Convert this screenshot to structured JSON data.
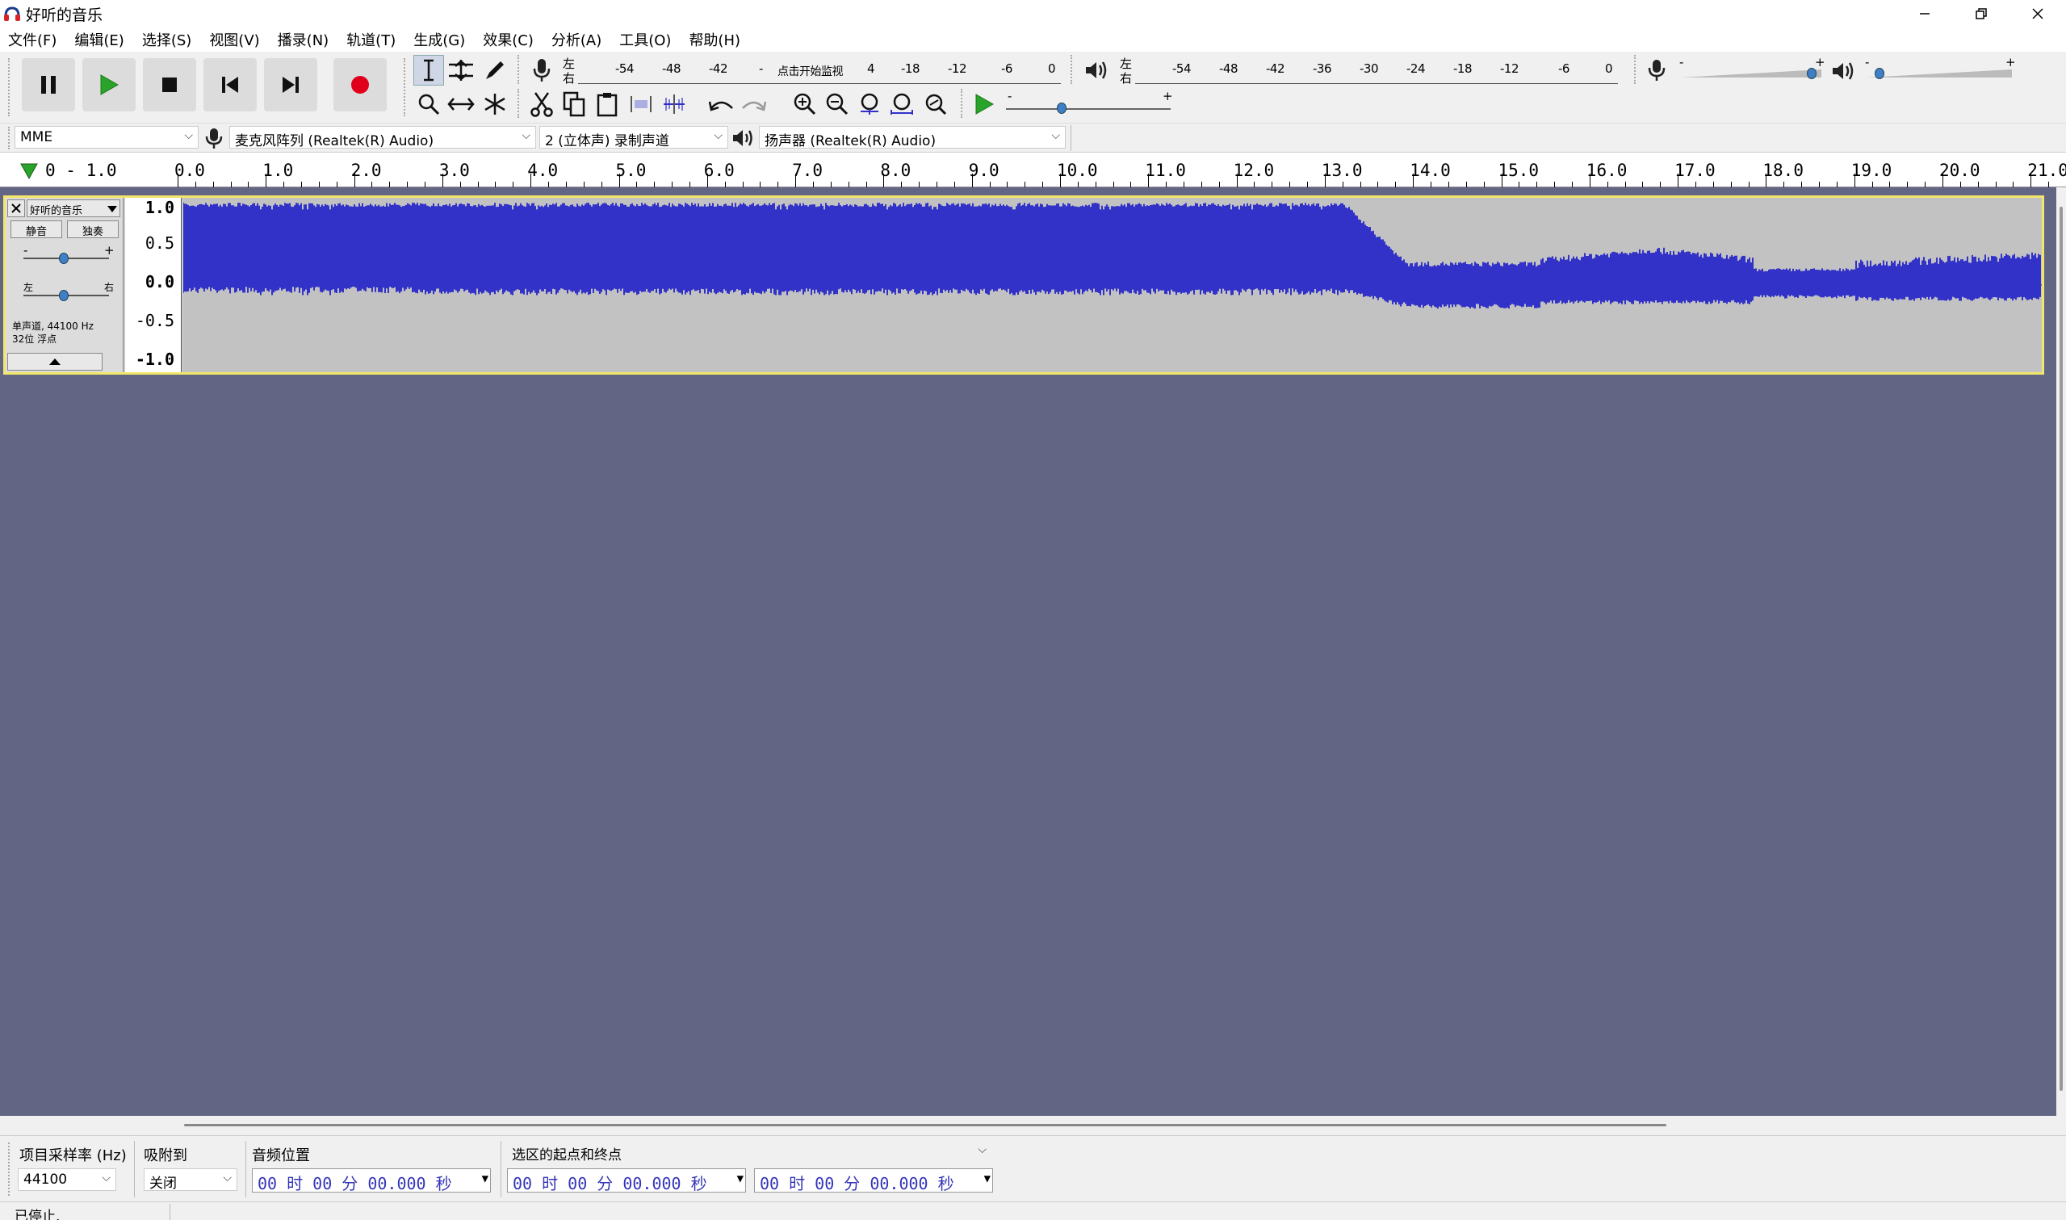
{
  "window": {
    "title": "好听的音乐"
  },
  "menu": [
    "文件(F)",
    "编辑(E)",
    "选择(S)",
    "视图(V)",
    "播录(N)",
    "轨道(T)",
    "生成(G)",
    "效果(C)",
    "分析(A)",
    "工具(O)",
    "帮助(H)"
  ],
  "meters": {
    "record_scale": [
      "-54",
      "-48",
      "-42",
      "-",
      "4",
      "-18",
      "-12",
      "-6",
      "0"
    ],
    "record_click_text": "点击开始监视",
    "playback_scale": [
      "-54",
      "-48",
      "-42",
      "-36",
      "-30",
      "-24",
      "-18",
      "-12",
      "-6",
      "0"
    ],
    "channel_top": "左",
    "channel_bottom": "右",
    "minus": "-",
    "plus": "+",
    "record_volume_level": 0.95,
    "playback_volume_level": 0.07,
    "play_speed_level": 0.33
  },
  "devices": {
    "host": "MME",
    "recording_device": "麦克风阵列 (Realtek(R) Audio)",
    "channels": "2 (立体声) 录制声道",
    "playback_device": "扬声器 (Realtek(R) Audio)"
  },
  "ruler": {
    "left_label": "0 - 1.0",
    "ticks": [
      "0.0",
      "1.0",
      "2.0",
      "3.0",
      "4.0",
      "5.0",
      "6.0",
      "7.0",
      "8.0",
      "9.0",
      "10.0",
      "11.0",
      "12.0",
      "13.0",
      "14.0",
      "15.0",
      "16.0",
      "17.0",
      "18.0",
      "19.0",
      "20.0",
      "21.0"
    ]
  },
  "track": {
    "name": "好听的音乐",
    "mute": "静音",
    "solo": "独奏",
    "gain_minus": "-",
    "gain_plus": "+",
    "pan_left": "左",
    "pan_right": "右",
    "info_line1": "单声道, 44100 Hz",
    "info_line2": "32位 浮点",
    "scale": [
      "1.0",
      "0.5",
      "0.0",
      "-0.5",
      "-1.0"
    ],
    "gain_level": 0.5,
    "pan_level": 0.5
  },
  "selection_toolbar": {
    "rate_label": "项目采样率 (Hz)",
    "rate_value": "44100",
    "snap_label": "吸附到",
    "snap_value": "关闭",
    "position_label": "音频位置",
    "position_value": "00 时 00 分 00.000 秒",
    "selection_label": "选区的起点和终点",
    "start_value": "00 时 00 分 00.000 秒",
    "end_value": "00 时 00 分 00.000 秒"
  },
  "status": {
    "text": "已停止."
  },
  "colors": {
    "waveform": "#3232c8",
    "track_bg": "#636584",
    "record": "#e0001c",
    "play": "#29a329",
    "selected_border": "#f2e66a"
  }
}
